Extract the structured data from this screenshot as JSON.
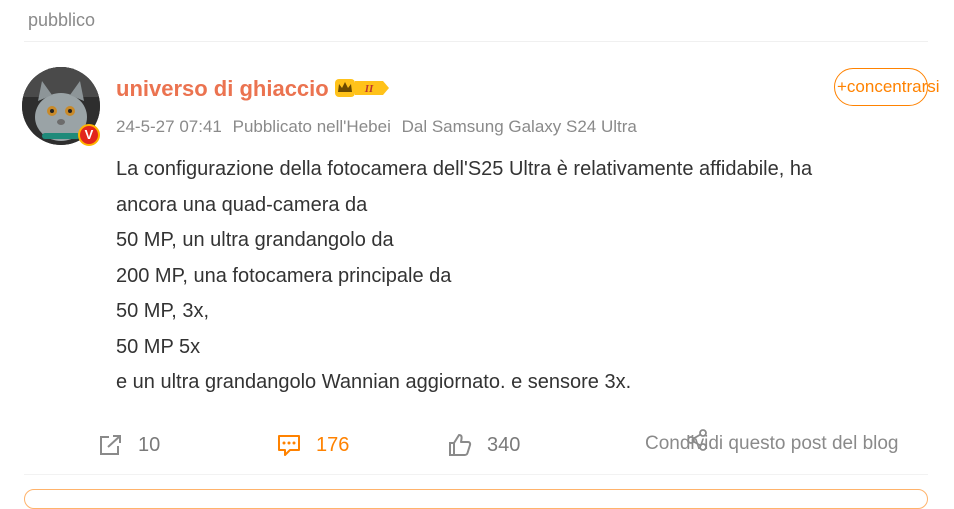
{
  "header": {
    "label": "pubblico"
  },
  "post": {
    "username": "universo di ghiaccio",
    "level_badge": "II",
    "follow_label": "+concentrarsi",
    "meta": {
      "date": "24-5-27 07:41",
      "location": "Pubblicato nell'Hebei",
      "device": "Dal Samsung Galaxy S24 Ultra"
    },
    "content_lines": [
      "La configurazione della fotocamera dell'S25 Ultra è relativamente affidabile, ha",
      "ancora una quad-camera da",
      "50 MP, un ultra grandangolo da",
      "200 MP, una fotocamera principale da",
      "50 MP, 3x,",
      "50 MP 5x",
      "e un ultra grandangolo Wannian aggiornato. e sensore 3x."
    ],
    "actions": {
      "reposts": "10",
      "comments": "176",
      "likes": "340",
      "share_label": "Condividi questo post del blog"
    }
  },
  "colors": {
    "accent": "#ff8200",
    "username": "#eb7350",
    "muted": "#8a8a8a"
  },
  "icons": [
    "repost-icon",
    "comment-icon",
    "like-icon",
    "share-icon",
    "crown-badge-icon",
    "verified-v-icon"
  ]
}
